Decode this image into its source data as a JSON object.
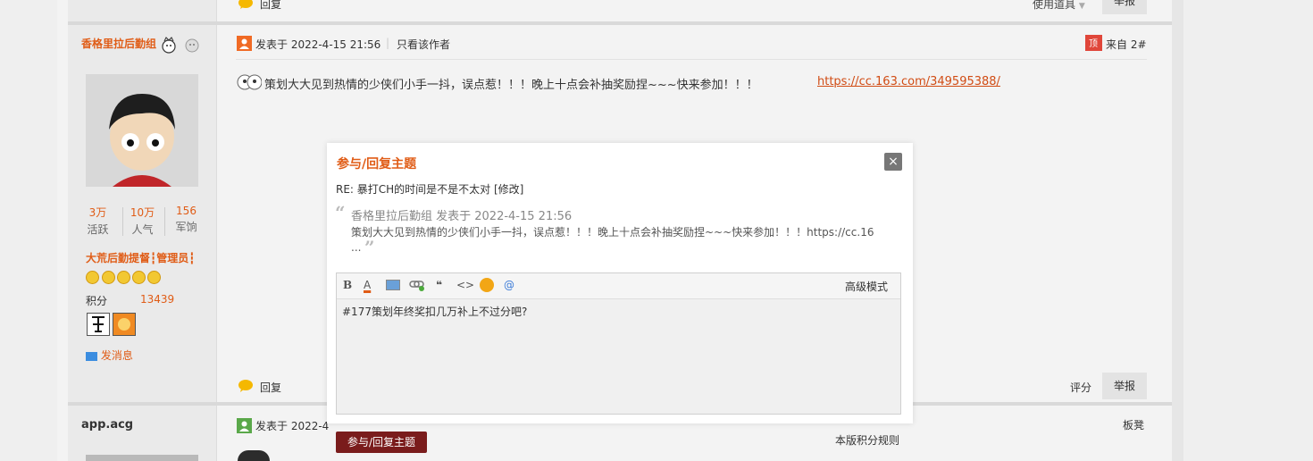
{
  "topbar": {
    "reply_label": "回复",
    "tools_label": "使用道具",
    "report_label": "举报"
  },
  "post1": {
    "username": "香格里拉后勤组",
    "stats": [
      {
        "value": "3万",
        "label": "活跃"
      },
      {
        "value": "10万",
        "label": "人气"
      },
      {
        "value": "156",
        "label": "军饷"
      }
    ],
    "group_title": "大荒后勤提督┇管理员┇",
    "points_label": "积分",
    "points_value": "13439",
    "send_msg": "发消息",
    "posted_at": "发表于 2022-4-15 21:56",
    "only_author": "只看该作者",
    "floor": "来自 2#",
    "content": "策划大大见到热情的少侠们小手一抖，误点惹！！！晚上十点会补抽奖励捏~~~快来参加！！！",
    "link": "https://cc.163.com/349595388/",
    "reply_label": "回复",
    "rate_label": "评分",
    "report_label": "举报"
  },
  "post2": {
    "username": "app.acg",
    "posted_at": "发表于 2022-4",
    "floor": "板凳"
  },
  "dialog": {
    "title": "参与/回复主题",
    "close": "×",
    "subject": "RE: 暴打CH的时间是不是不太对 [修改]",
    "quote_header": "香格里拉后勤组 发表于 2022-4-15 21:56",
    "quote_body": "策划大大见到热情的少侠们小手一抖，误点惹！！！晚上十点会补抽奖励捏~~~快来参加！！！https://cc.16",
    "quote_more": "...",
    "advanced_mode": "高级模式",
    "editor_text": "#177策划年终奖扣几万补上不过分吧?",
    "submit": "参与/回复主题",
    "rules": "本版积分规则"
  },
  "colors": {
    "accent": "#e05c16",
    "submit_bg": "#7a1c1c"
  }
}
